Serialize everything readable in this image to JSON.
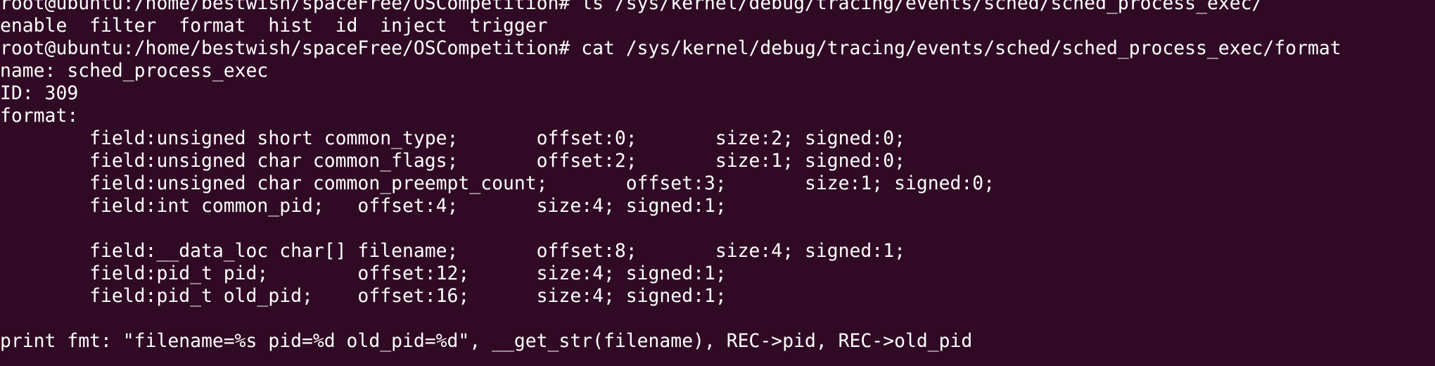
{
  "terminal": {
    "lines": [
      "root@ubuntu:/home/bestwish/spaceFree/OSCompetition# ls /sys/kernel/debug/tracing/events/sched/sched_process_exec/",
      "enable  filter  format  hist  id  inject  trigger",
      "root@ubuntu:/home/bestwish/spaceFree/OSCompetition# cat /sys/kernel/debug/tracing/events/sched/sched_process_exec/format",
      "name: sched_process_exec",
      "ID: 309",
      "format:",
      "        field:unsigned short common_type;       offset:0;       size:2; signed:0;",
      "        field:unsigned char common_flags;       offset:2;       size:1; signed:0;",
      "        field:unsigned char common_preempt_count;       offset:3;       size:1; signed:0;",
      "        field:int common_pid;   offset:4;       size:4; signed:1;",
      "",
      "        field:__data_loc char[] filename;       offset:8;       size:4; signed:1;",
      "        field:pid_t pid;        offset:12;      size:4; signed:1;",
      "        field:pid_t old_pid;    offset:16;      size:4; signed:1;",
      "",
      "print fmt: \"filename=%s pid=%d old_pid=%d\", __get_str(filename), REC->pid, REC->old_pid"
    ]
  }
}
